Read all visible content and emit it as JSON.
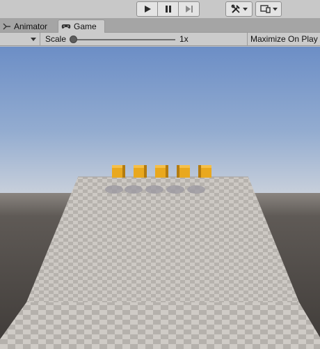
{
  "toolbar": {
    "play_icon": "play-icon",
    "pause_icon": "pause-icon",
    "step_icon": "step-icon",
    "tools_icon": "tools-icon",
    "layout_icon": "layout-icon"
  },
  "tabs": [
    {
      "label": "Animator",
      "icon": "animator-icon",
      "active": false
    },
    {
      "label": "Game",
      "icon": "gamepad-icon",
      "active": true
    }
  ],
  "gamebar": {
    "scale_label": "Scale",
    "scale_value": "1x",
    "maximize_label": "Maximize On Play"
  },
  "scene": {
    "sky_top_color": "#6b8cc3",
    "sky_horizon_color": "#c9d1dc",
    "ground_color": "#595450",
    "plane_light_color": "#cfcbc6",
    "plane_dark_color": "#b4b0ab",
    "cube_color": "#e8a71e",
    "cube_count": 5
  },
  "colors": {
    "toolbar_bg": "#c8c8c8",
    "tab_active_bg": "#cbcbcb",
    "tabbar_bg": "#a5a5a5"
  }
}
